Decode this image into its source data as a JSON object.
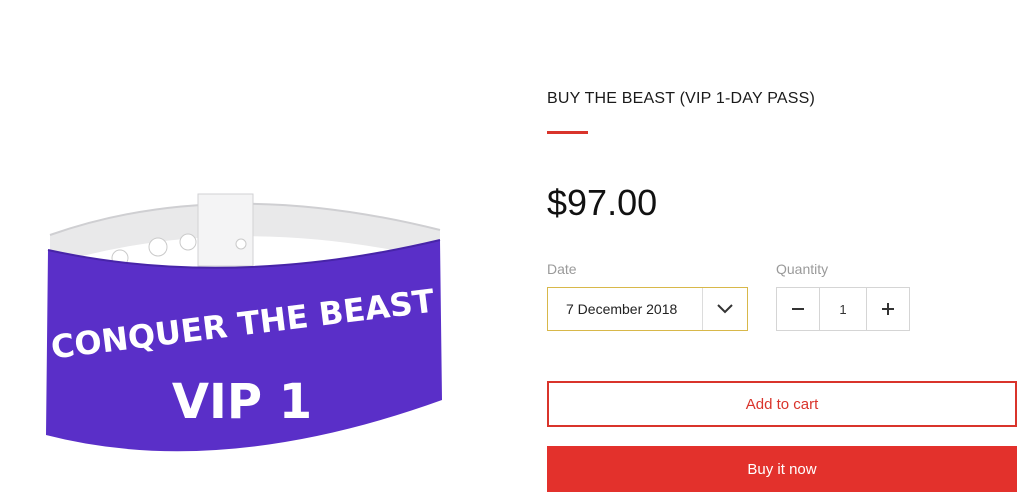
{
  "product": {
    "image_text_line1": "CONQUER THE BEAST",
    "image_text_line2": "VIP 1",
    "title": "BUY THE BEAST (VIP 1-DAY PASS)",
    "price": "$97.00",
    "accent_color": "#d9342b"
  },
  "options": {
    "date_label": "Date",
    "date_value": "7 December 2018",
    "quantity_label": "Quantity",
    "quantity_value": "1"
  },
  "icons": {
    "date_dropdown": "chevron-down-icon",
    "qty_decrease": "minus-icon",
    "qty_increase": "plus-icon"
  },
  "actions": {
    "add_to_cart": "Add to cart",
    "buy_now": "Buy it now"
  }
}
